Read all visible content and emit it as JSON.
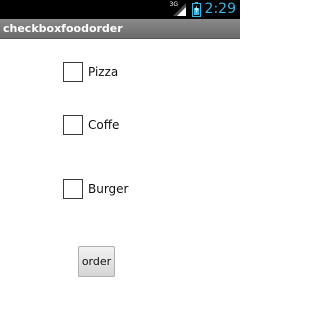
{
  "status_bar": {
    "network_label": "3G",
    "time": "2:29",
    "icons": [
      "signal-icon",
      "battery-icon"
    ],
    "time_color": "#33b5e5"
  },
  "app": {
    "title": "checkboxfoodorder"
  },
  "options": [
    {
      "label": "Pizza",
      "checked": false
    },
    {
      "label": "Coffe",
      "checked": false
    },
    {
      "label": "Burger",
      "checked": false
    }
  ],
  "order_button": {
    "label": "order"
  }
}
